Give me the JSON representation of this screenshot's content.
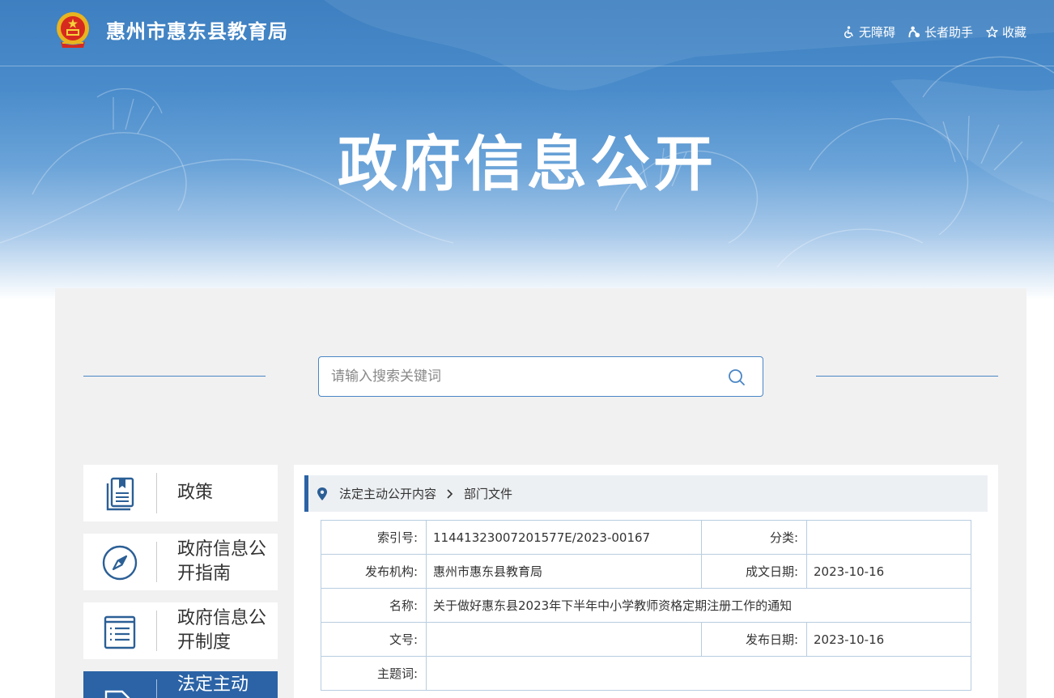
{
  "header": {
    "site_name": "惠州市惠东县教育局",
    "links": [
      {
        "label": "无障碍",
        "icon": "accessibility-icon"
      },
      {
        "label": "长者助手",
        "icon": "elder-assist-icon"
      },
      {
        "label": "收藏",
        "icon": "star-icon"
      }
    ],
    "banner_title": "政府信息公开"
  },
  "search": {
    "placeholder": "请输入搜索关键词"
  },
  "sidebar": {
    "items": [
      {
        "label": "政策",
        "icon": "policy-book-icon"
      },
      {
        "label": "政府信息公开指南",
        "icon": "compass-icon"
      },
      {
        "label": "政府信息公开制度",
        "icon": "list-document-icon"
      },
      {
        "label": "法定主动",
        "icon": "document-icon"
      }
    ]
  },
  "breadcrumb": {
    "items": [
      "法定主动公开内容",
      "部门文件"
    ]
  },
  "meta": {
    "index_no_label": "索引号:",
    "index_no": "11441323007201577E/2023-00167",
    "category_label": "分类:",
    "category": "",
    "publisher_label": "发布机构:",
    "publisher": "惠州市惠东县教育局",
    "created_label": "成文日期:",
    "created": "2023-10-16",
    "name_label": "名称:",
    "name": "关于做好惠东县2023年下半年中小学教师资格定期注册工作的通知",
    "doc_no_label": "文号:",
    "doc_no": "",
    "published_label": "发布日期:",
    "published": "2023-10-16",
    "keywords_label": "主题词:",
    "keywords": ""
  },
  "colors": {
    "primary": "#2b63a6",
    "banner": "#4a8ccb",
    "panel": "#f1f1f1",
    "border": "#b9cde0"
  }
}
